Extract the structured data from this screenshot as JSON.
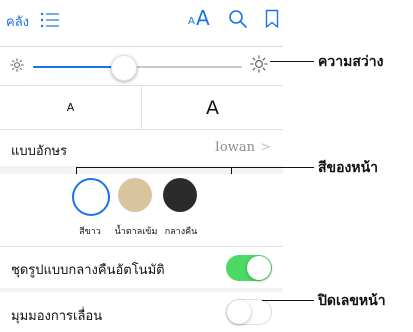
{
  "toolbar": {
    "library_label": "คลัง",
    "list_icon": "list-icon",
    "font_size_small": "A",
    "font_size_large": "A",
    "search_icon": "search-icon",
    "bookmark_icon": "bookmark-icon",
    "accent_color": "#1a73e8"
  },
  "panel": {
    "brightness": {
      "value_fraction": 0.43,
      "min_icon": "sun-small-icon",
      "max_icon": "sun-large-icon"
    },
    "text_size": {
      "decrease_label": "A",
      "increase_label": "A"
    },
    "font": {
      "label": "แบบอักษร",
      "value": "Iowan",
      "chevron": ">"
    },
    "themes": [
      {
        "label": "สีขาว",
        "color": "#ffffff",
        "selected": true
      },
      {
        "label": "น้ำตาลเข้ม",
        "color": "#d8c59e",
        "selected": false
      },
      {
        "label": "กลางคืน",
        "color": "#2b2b2b",
        "selected": false
      }
    ],
    "auto_night": {
      "label": "ชุดรูปแบบกลางคืนอัตโนมัติ",
      "on": true,
      "on_color": "#4cd964"
    },
    "scrolling_view": {
      "label": "มุมมองการเลื่อน",
      "on": false
    }
  },
  "callouts": {
    "brightness": "ความสว่าง",
    "theme_color": "สีของหน้า",
    "page_numbers": "ปิดเลขหน้า"
  }
}
